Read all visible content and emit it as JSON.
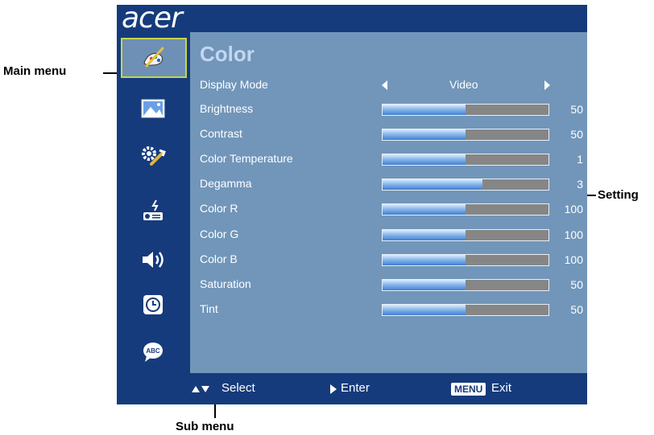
{
  "brand": {
    "logo": "acer"
  },
  "sidebar": {
    "items": [
      {
        "name": "color-icon",
        "selected": true
      },
      {
        "name": "image-icon",
        "selected": false
      },
      {
        "name": "settings-icon",
        "selected": false
      },
      {
        "name": "management-icon",
        "selected": false
      },
      {
        "name": "audio-icon",
        "selected": false
      },
      {
        "name": "timer-icon",
        "selected": false
      },
      {
        "name": "language-icon",
        "selected": false
      }
    ]
  },
  "menu": {
    "title": "Color",
    "display_mode": {
      "label": "Display Mode",
      "value": "Video"
    },
    "rows": [
      {
        "label": "Brightness",
        "value": "50",
        "level": 0.5
      },
      {
        "label": "Contrast",
        "value": "50",
        "level": 0.5
      },
      {
        "label": "Color Temperature",
        "value": "1",
        "level": 0.5
      },
      {
        "label": "Degamma",
        "value": "3",
        "level": 0.6
      },
      {
        "label": "Color R",
        "value": "100",
        "level": 0.5
      },
      {
        "label": "Color G",
        "value": "100",
        "level": 0.5
      },
      {
        "label": "Color B",
        "value": "100",
        "level": 0.5
      },
      {
        "label": "Saturation",
        "value": "50",
        "level": 0.5
      },
      {
        "label": "Tint",
        "value": "50",
        "level": 0.5
      }
    ]
  },
  "footer": {
    "select_label": "Select",
    "enter_label": "Enter",
    "menu_key": "MENU",
    "exit_label": "Exit"
  },
  "callouts": {
    "main_menu": "Main menu",
    "setting": "Setting",
    "sub_menu": "Sub menu"
  },
  "colors": {
    "panel": "#7196ba",
    "bars": "#153b7c",
    "title": "#c4d6f0",
    "selection_border": "#c7d54a"
  }
}
